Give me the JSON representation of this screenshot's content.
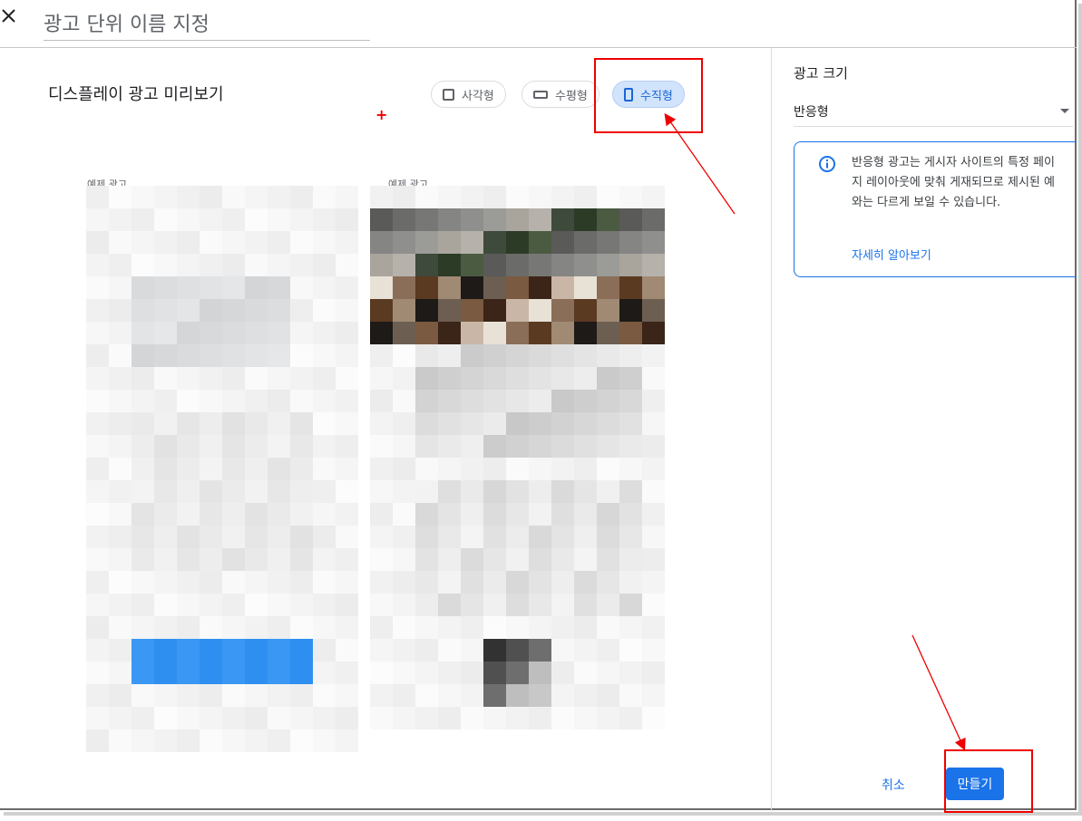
{
  "header": {
    "close_icon": "close-icon",
    "name_placeholder": "광고 단위 이름 지정"
  },
  "preview": {
    "title": "디스플레이 광고 미리보기",
    "shapes": [
      {
        "label": "사각형",
        "icon": "square-icon",
        "selected": false
      },
      {
        "label": "수평형",
        "icon": "horizontal-rect-icon",
        "selected": false
      },
      {
        "label": "수직형",
        "icon": "vertical-rect-icon",
        "selected": true
      }
    ],
    "ad_labels": [
      "예제 광고",
      "예제 광고"
    ]
  },
  "panel": {
    "ad_size_title": "광고 크기",
    "ad_size_value": "반응형",
    "info_icon": "info-icon",
    "info_text": "반응형 광고는 게시자 사이트의 특정 페이지 레이아웃에 맞춰 게재되므로 제시된 예와는 다르게 보일 수 있습니다.",
    "learn_more": "자세히 알아보기",
    "cancel_label": "취소",
    "create_label": "만들기"
  },
  "colors": {
    "accent": "#1a73e8",
    "chip_selected_bg": "#d2e3fc",
    "annotation": "#e00000"
  }
}
